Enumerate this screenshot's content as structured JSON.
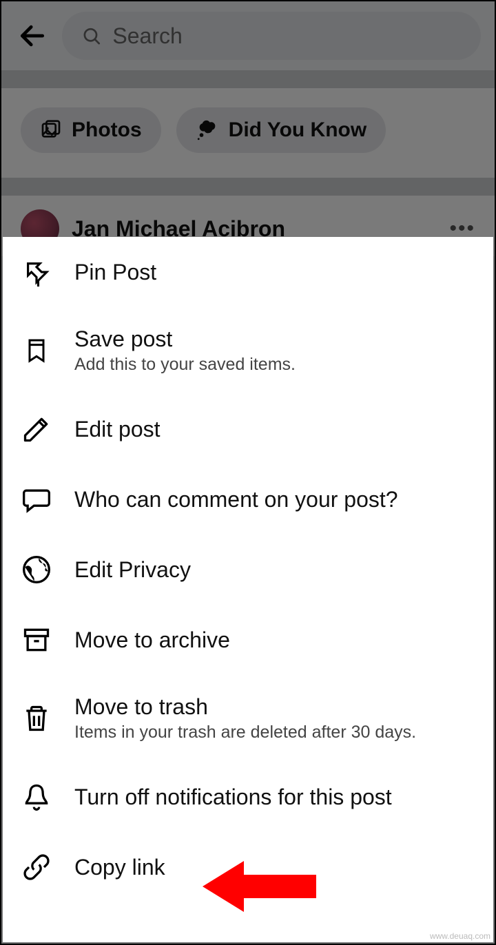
{
  "search": {
    "placeholder": "Search"
  },
  "chips": {
    "photos": "Photos",
    "didYouKnow": "Did You Know"
  },
  "post": {
    "authorName": "Jan Michael Acibron"
  },
  "menu": {
    "pinPost": {
      "title": "Pin Post"
    },
    "savePost": {
      "title": "Save post",
      "subtitle": "Add this to your saved items."
    },
    "editPost": {
      "title": "Edit post"
    },
    "whoComment": {
      "title": "Who can comment on your post?"
    },
    "editPrivacy": {
      "title": "Edit Privacy"
    },
    "moveArchive": {
      "title": "Move to archive"
    },
    "moveTrash": {
      "title": "Move to trash",
      "subtitle": "Items in your trash are deleted after 30 days."
    },
    "turnOffNotif": {
      "title": "Turn off notifications for this post"
    },
    "copyLink": {
      "title": "Copy link"
    }
  },
  "watermark": "www.deuaq.com"
}
